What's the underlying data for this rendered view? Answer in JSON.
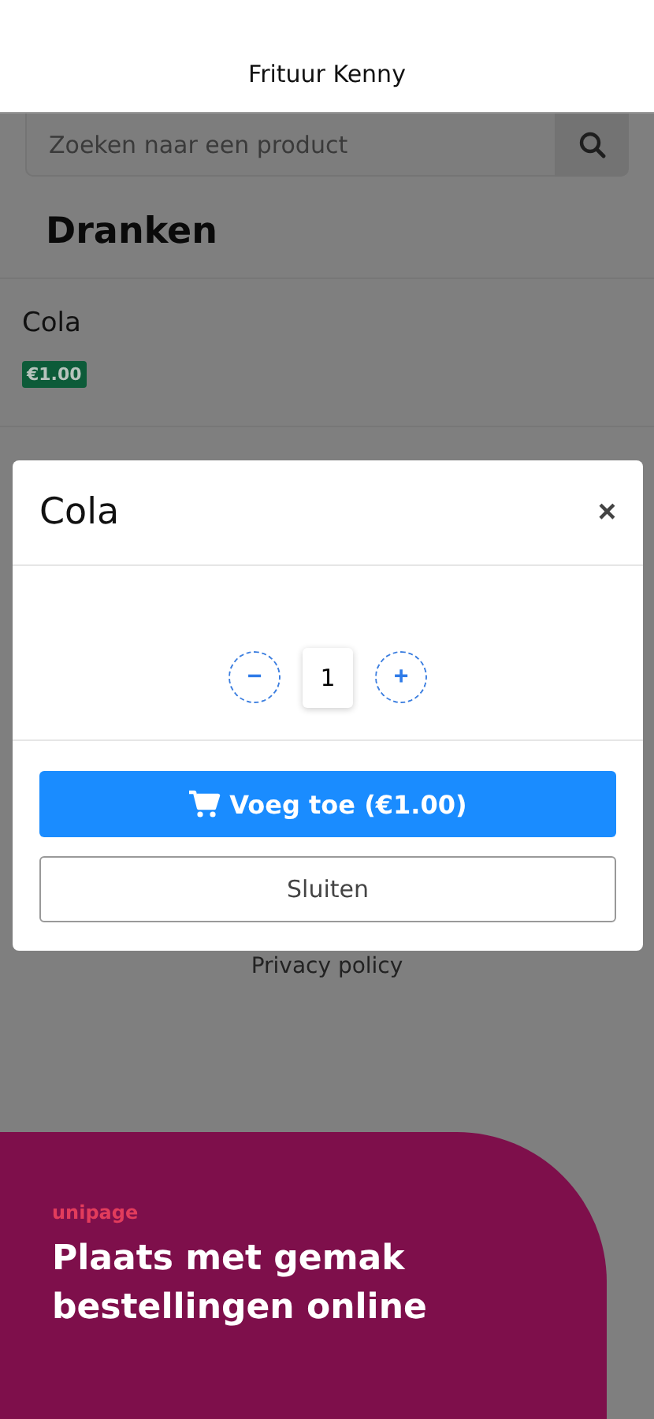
{
  "header": {
    "title": "Frituur Kenny"
  },
  "search": {
    "placeholder": "Zoeken naar een product"
  },
  "category": {
    "title": "Dranken"
  },
  "products": [
    {
      "name": "Cola",
      "price": "€1.00"
    }
  ],
  "footer": {
    "link": "Privacy policy"
  },
  "modal": {
    "title": "Cola",
    "close": "×",
    "quantity": "1",
    "minus": "−",
    "plus": "+",
    "add_button": "Voeg toe (€1.00)",
    "close_button": "Sluiten"
  },
  "banner": {
    "logo": "unipage",
    "headline": "Plaats met gemak bestellingen online"
  }
}
